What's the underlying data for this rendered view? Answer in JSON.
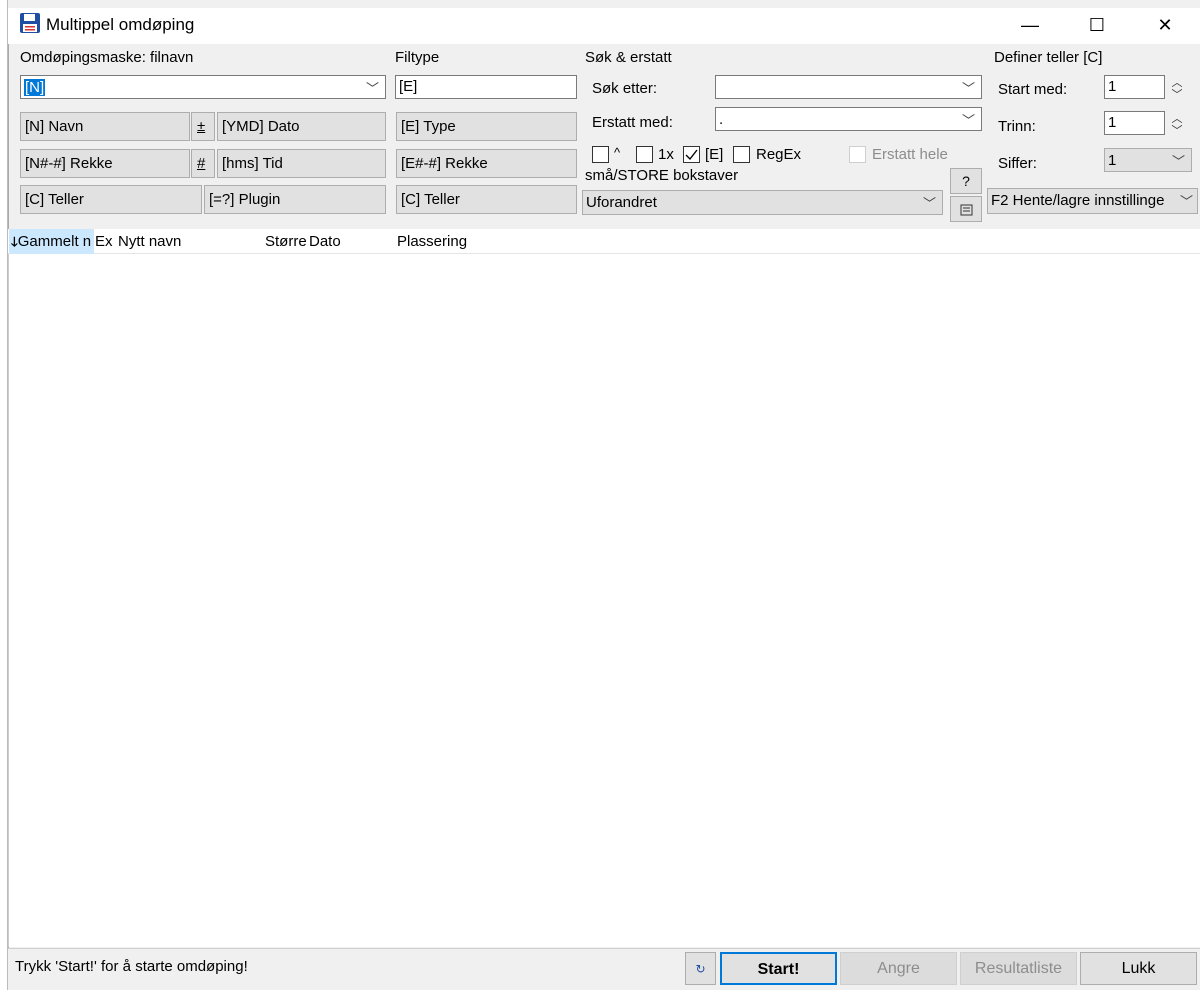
{
  "window": {
    "title": "Multippel omdøping",
    "minimize": "—",
    "maximize": "☐",
    "close": "✕"
  },
  "mask_group": {
    "label": "Omdøpingsmaske: filnavn",
    "value": "[N]",
    "buttons": {
      "name": "[N]  Navn",
      "plusminus": "±",
      "date": "[YMD]  Dato",
      "range": "[N#-#] Rekke",
      "hash": "#",
      "time": "[hms]  Tid",
      "counter": "[C]  Teller",
      "plugin": "[=?]  Plugin"
    }
  },
  "ext_group": {
    "label": "Filtype",
    "value": "[E]",
    "buttons": {
      "type": "[E]  Type",
      "range": "[E#-#] Rekke",
      "counter": "[C]  Teller"
    }
  },
  "search_group": {
    "label": "Søk & erstatt",
    "search_label": "Søk etter:",
    "search_value": "",
    "replace_label": "Erstatt med:",
    "replace_value": ".",
    "opt_caret": "^",
    "opt_once": "1x",
    "opt_ext": "[E]",
    "opt_regex": "RegEx",
    "opt_replace_all": "Erstatt hele",
    "help": "?",
    "case_label": "små/STORE bokstaver",
    "case_value": "Uforandret"
  },
  "counter_group": {
    "label": "Definer teller [C]",
    "start_label": "Start med:",
    "start_value": "1",
    "step_label": "Trinn:",
    "step_value": "1",
    "digits_label": "Siffer:",
    "digits_value": "1",
    "settings": "F2 Hente/lagre innstillinge"
  },
  "list": {
    "columns": [
      "Gammelt n",
      "Ex",
      "Nytt navn",
      "Større",
      "Dato",
      "Plassering"
    ]
  },
  "status": {
    "text": "Trykk 'Start!' for å starte omdøping!",
    "start": "Start!",
    "undo": "Angre",
    "result": "Resultatliste",
    "close": "Lukk"
  }
}
